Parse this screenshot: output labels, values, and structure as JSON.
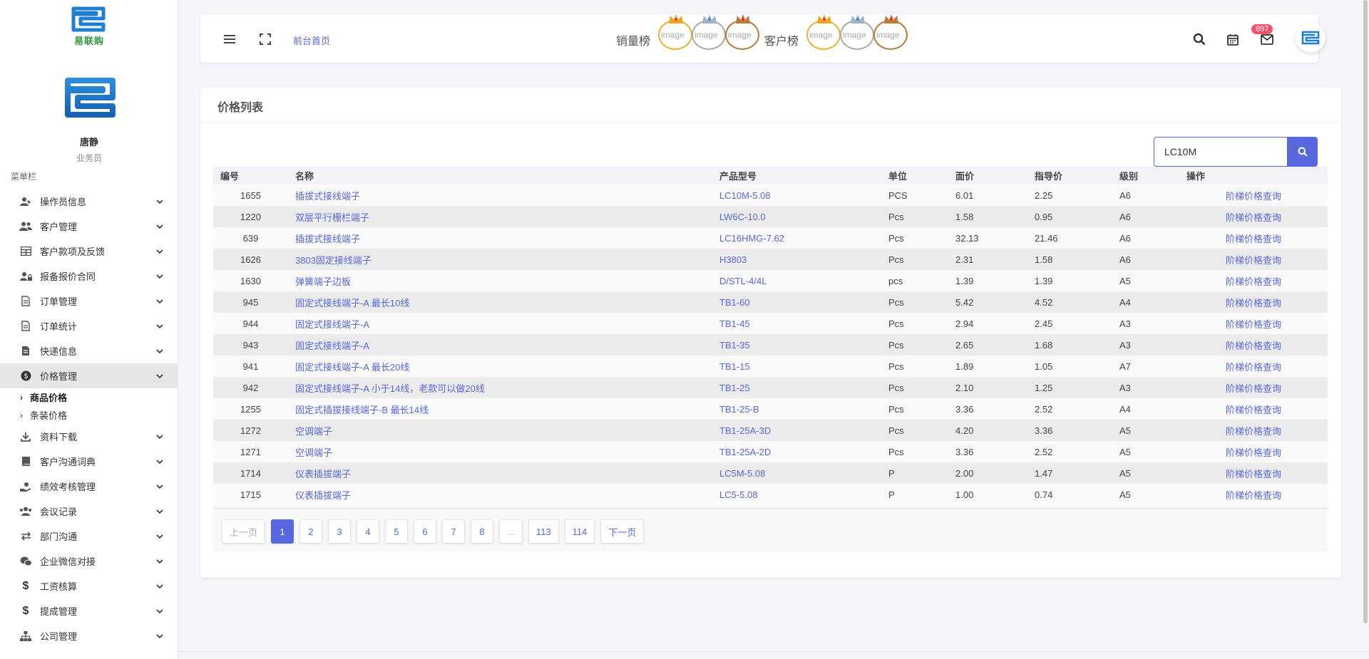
{
  "sidebar": {
    "brand_text": "易联购",
    "user_name": "唐静",
    "user_role": "业务员",
    "menu_caption": "菜单栏",
    "items": [
      {
        "label": "操作员信息",
        "icon": "user-edit-icon"
      },
      {
        "label": "客户管理",
        "icon": "users-icon"
      },
      {
        "label": "客户款项及反馈",
        "icon": "table-icon"
      },
      {
        "label": "报备报价合同",
        "icon": "user-lock-icon"
      },
      {
        "label": "订单管理",
        "icon": "file-icon"
      },
      {
        "label": "订单统计",
        "icon": "file-icon"
      },
      {
        "label": "快递信息",
        "icon": "file-icon"
      },
      {
        "label": "价格管理",
        "icon": "dollar-circle-icon"
      },
      {
        "label": "资料下载",
        "icon": "download-icon"
      },
      {
        "label": "客户沟通词典",
        "icon": "book-icon"
      },
      {
        "label": "绩效考核管理",
        "icon": "hand-holding-icon"
      },
      {
        "label": "会议记录",
        "icon": "users-icon"
      },
      {
        "label": "部门沟通",
        "icon": "exchange-icon"
      },
      {
        "label": "企业微信对接",
        "icon": "wechat-icon"
      },
      {
        "label": "工资核算",
        "icon": "dollar-icon"
      },
      {
        "label": "提成管理",
        "icon": "dollar-icon"
      },
      {
        "label": "公司管理",
        "icon": "sitemap-icon"
      }
    ],
    "price_submenu": [
      {
        "label": "商品价格"
      },
      {
        "label": "条装价格"
      }
    ]
  },
  "header": {
    "front_page_link": "前台首页",
    "sales_rank_label": "销量榜",
    "customer_rank_label": "客户榜",
    "avatar_alt": "image",
    "notification_count": "897"
  },
  "panel": {
    "title": "价格列表",
    "search_value": "LC10M"
  },
  "table": {
    "columns": [
      "编号",
      "名称",
      "产品型号",
      "单位",
      "面价",
      "指导价",
      "级别",
      "操作"
    ],
    "rows": [
      {
        "id": "1655",
        "name": "插拔式接线端子",
        "model": "LC10M-5.08",
        "unit": "PCS",
        "face_price": "6.01",
        "guide_price": "2.25",
        "level": "A6",
        "action": "阶梯价格查询"
      },
      {
        "id": "1220",
        "name": "双层平行栅栏端子",
        "model": "LW6C-10.0",
        "unit": "Pcs",
        "face_price": "1.58",
        "guide_price": "0.95",
        "level": "A6",
        "action": "阶梯价格查询"
      },
      {
        "id": "639",
        "name": "插拔式接线端子",
        "model": "LC16HMG-7.62",
        "unit": "Pcs",
        "face_price": "32.13",
        "guide_price": "21.46",
        "level": "A6",
        "action": "阶梯价格查询"
      },
      {
        "id": "1626",
        "name": "3803固定接线端子",
        "model": "H3803",
        "unit": "Pcs",
        "face_price": "2.31",
        "guide_price": "1.58",
        "level": "A6",
        "action": "阶梯价格查询"
      },
      {
        "id": "1630",
        "name": "弹簧端子边板",
        "model": "D/STL-4/4L",
        "unit": "pcs",
        "face_price": "1.39",
        "guide_price": "1.39",
        "level": "A5",
        "action": "阶梯价格查询"
      },
      {
        "id": "945",
        "name": "固定式接线端子-A 最长10线",
        "model": "TB1-60",
        "unit": "Pcs",
        "face_price": "5.42",
        "guide_price": "4.52",
        "level": "A4",
        "action": "阶梯价格查询"
      },
      {
        "id": "944",
        "name": "固定式接线端子-A",
        "model": "TB1-45",
        "unit": "Pcs",
        "face_price": "2.94",
        "guide_price": "2.45",
        "level": "A3",
        "action": "阶梯价格查询"
      },
      {
        "id": "943",
        "name": "固定式接线端子-A",
        "model": "TB1-35",
        "unit": "Pcs",
        "face_price": "2.65",
        "guide_price": "1.68",
        "level": "A3",
        "action": "阶梯价格查询"
      },
      {
        "id": "941",
        "name": "固定式接线端子-A 最长20线",
        "model": "TB1-15",
        "unit": "Pcs",
        "face_price": "1.89",
        "guide_price": "1.05",
        "level": "A7",
        "action": "阶梯价格查询"
      },
      {
        "id": "942",
        "name": "固定式接线端子-A 小于14线，老款可以做20线",
        "model": "TB1-25",
        "unit": "Pcs",
        "face_price": "2.10",
        "guide_price": "1.25",
        "level": "A3",
        "action": "阶梯价格查询"
      },
      {
        "id": "1255",
        "name": "固定式插拔接线端子-B 最长14线",
        "model": "TB1-25-B",
        "unit": "Pcs",
        "face_price": "3.36",
        "guide_price": "2.52",
        "level": "A4",
        "action": "阶梯价格查询"
      },
      {
        "id": "1272",
        "name": "空调端子",
        "model": "TB1-25A-3D",
        "unit": "Pcs",
        "face_price": "4.20",
        "guide_price": "3.36",
        "level": "A5",
        "action": "阶梯价格查询"
      },
      {
        "id": "1271",
        "name": "空调端子",
        "model": "TB1-25A-2D",
        "unit": "Pcs",
        "face_price": "3.36",
        "guide_price": "2.52",
        "level": "A5",
        "action": "阶梯价格查询"
      },
      {
        "id": "1714",
        "name": "仪表插拔端子",
        "model": "LC5M-5.08",
        "unit": "P",
        "face_price": "2.00",
        "guide_price": "1.47",
        "level": "A5",
        "action": "阶梯价格查询"
      },
      {
        "id": "1715",
        "name": "仪表插拔端子",
        "model": "LC5-5.08",
        "unit": "P",
        "face_price": "1.00",
        "guide_price": "0.74",
        "level": "A5",
        "action": "阶梯价格查询"
      }
    ]
  },
  "pagination": {
    "prev": "上一页",
    "next": "下一页",
    "pages": [
      "1",
      "2",
      "3",
      "4",
      "5",
      "6",
      "7",
      "8",
      "...",
      "113",
      "114"
    ],
    "current": "1"
  },
  "colors": {
    "accent": "#5867dd",
    "badge": "#f4516c",
    "brand_green": "#2e9a3b",
    "brand_blue": "#1e7fd0"
  }
}
